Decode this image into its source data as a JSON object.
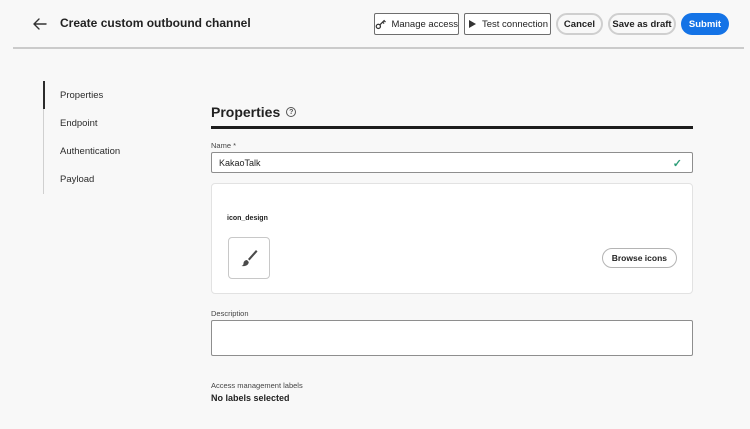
{
  "header": {
    "title": "Create custom outbound channel",
    "manage_access_label": "Manage access",
    "test_connection_label": "Test connection",
    "cancel_label": "Cancel",
    "save_draft_label": "Save as draft",
    "submit_label": "Submit"
  },
  "sidenav": {
    "items": [
      {
        "label": "Properties",
        "active": true
      },
      {
        "label": "Endpoint"
      },
      {
        "label": "Authentication"
      },
      {
        "label": "Payload"
      }
    ]
  },
  "properties": {
    "heading": "Properties",
    "name_label": "Name",
    "name_required": "*",
    "name_value": "KakaoTalk",
    "icon_label": "icon_design",
    "browse_icons_label": "Browse icons",
    "description_label": "Description",
    "description_value": "",
    "access_labels_label": "Access management labels",
    "access_labels_value": "No labels selected"
  },
  "icons": {
    "back": "arrow-left-icon",
    "manage_access": "key-icon",
    "test_connection": "play-icon",
    "help": "help-circle-icon",
    "valid": "checkmark-icon",
    "icon_preview": "paintbrush-icon"
  },
  "colors": {
    "accent": "#1473e6",
    "success": "#2d9d78"
  }
}
